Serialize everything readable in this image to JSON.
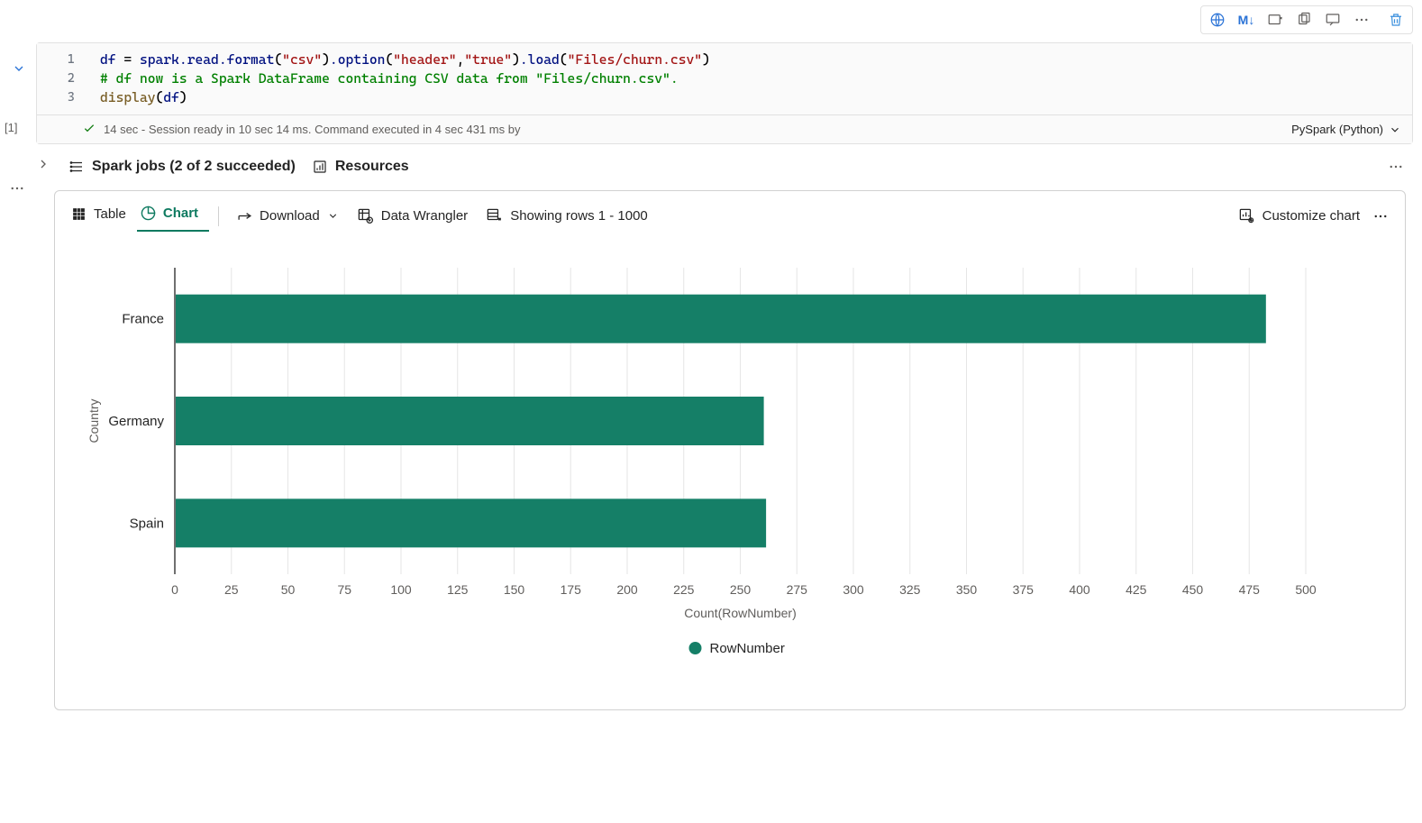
{
  "toolbar": {
    "markdown_label": "M↓"
  },
  "cell": {
    "code": {
      "line1": {
        "var": "df",
        "read": "spark.read.format",
        "csv": "\"csv\"",
        "opt": ".option",
        "header": "\"header\"",
        "true_v": "\"true\"",
        "load": ".load",
        "path": "\"Files/churn.csv\""
      },
      "line2_comment": "# df now is a Spark DataFrame containing CSV data from \"Files/churn.csv\".",
      "line3_fn": "display",
      "line3_arg": "df"
    },
    "exec_number": "[1]",
    "status_text": "14 sec - Session ready in 10 sec 14 ms. Command executed in 4 sec 431 ms by",
    "language": "PySpark (Python)"
  },
  "jobs": {
    "label": "Spark jobs (2 of 2 succeeded)",
    "resources": "Resources"
  },
  "output": {
    "table_tab": "Table",
    "chart_tab": "Chart",
    "download": "Download",
    "wrangler": "Data Wrangler",
    "showing": "Showing rows 1 - 1000",
    "customize": "Customize chart"
  },
  "chart_data": {
    "type": "bar",
    "orientation": "horizontal",
    "categories": [
      "France",
      "Germany",
      "Spain"
    ],
    "values": [
      482,
      260,
      261
    ],
    "xlabel": "Count(RowNumber)",
    "ylabel": "Country",
    "xlim": [
      0,
      500
    ],
    "x_ticks": [
      0,
      25,
      50,
      75,
      100,
      125,
      150,
      175,
      200,
      225,
      250,
      275,
      300,
      325,
      350,
      375,
      400,
      425,
      450,
      475,
      500
    ],
    "legend": "RowNumber",
    "color": "#157f67"
  }
}
